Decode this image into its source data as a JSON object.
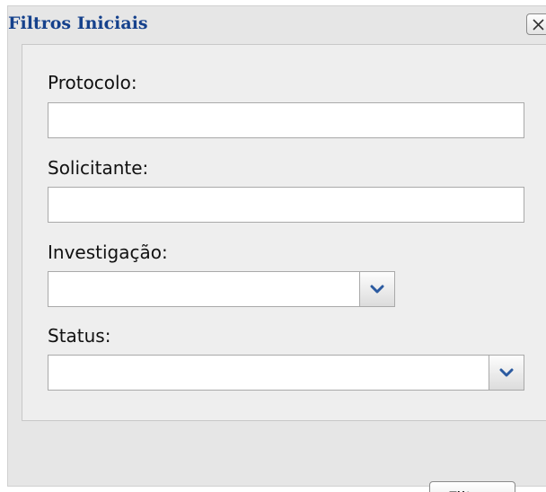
{
  "dialog": {
    "title": "Filtros Iniciais",
    "close_icon": "close-icon"
  },
  "fields": {
    "protocolo": {
      "label": "Protocolo:",
      "value": ""
    },
    "solicitante": {
      "label": "Solicitante:",
      "value": ""
    },
    "investigacao": {
      "label": "Investigação:",
      "selected": "",
      "dropdown_icon": "chevron-down-icon"
    },
    "status": {
      "label": "Status:",
      "selected": "",
      "dropdown_icon": "chevron-down-icon"
    }
  },
  "actions": {
    "filter_label": "Filtrar"
  },
  "colors": {
    "title": "#15418c",
    "chevron": "#2b5aa0",
    "dialog_bg": "#e6e6e6",
    "panel_bg": "#eeeeee"
  }
}
